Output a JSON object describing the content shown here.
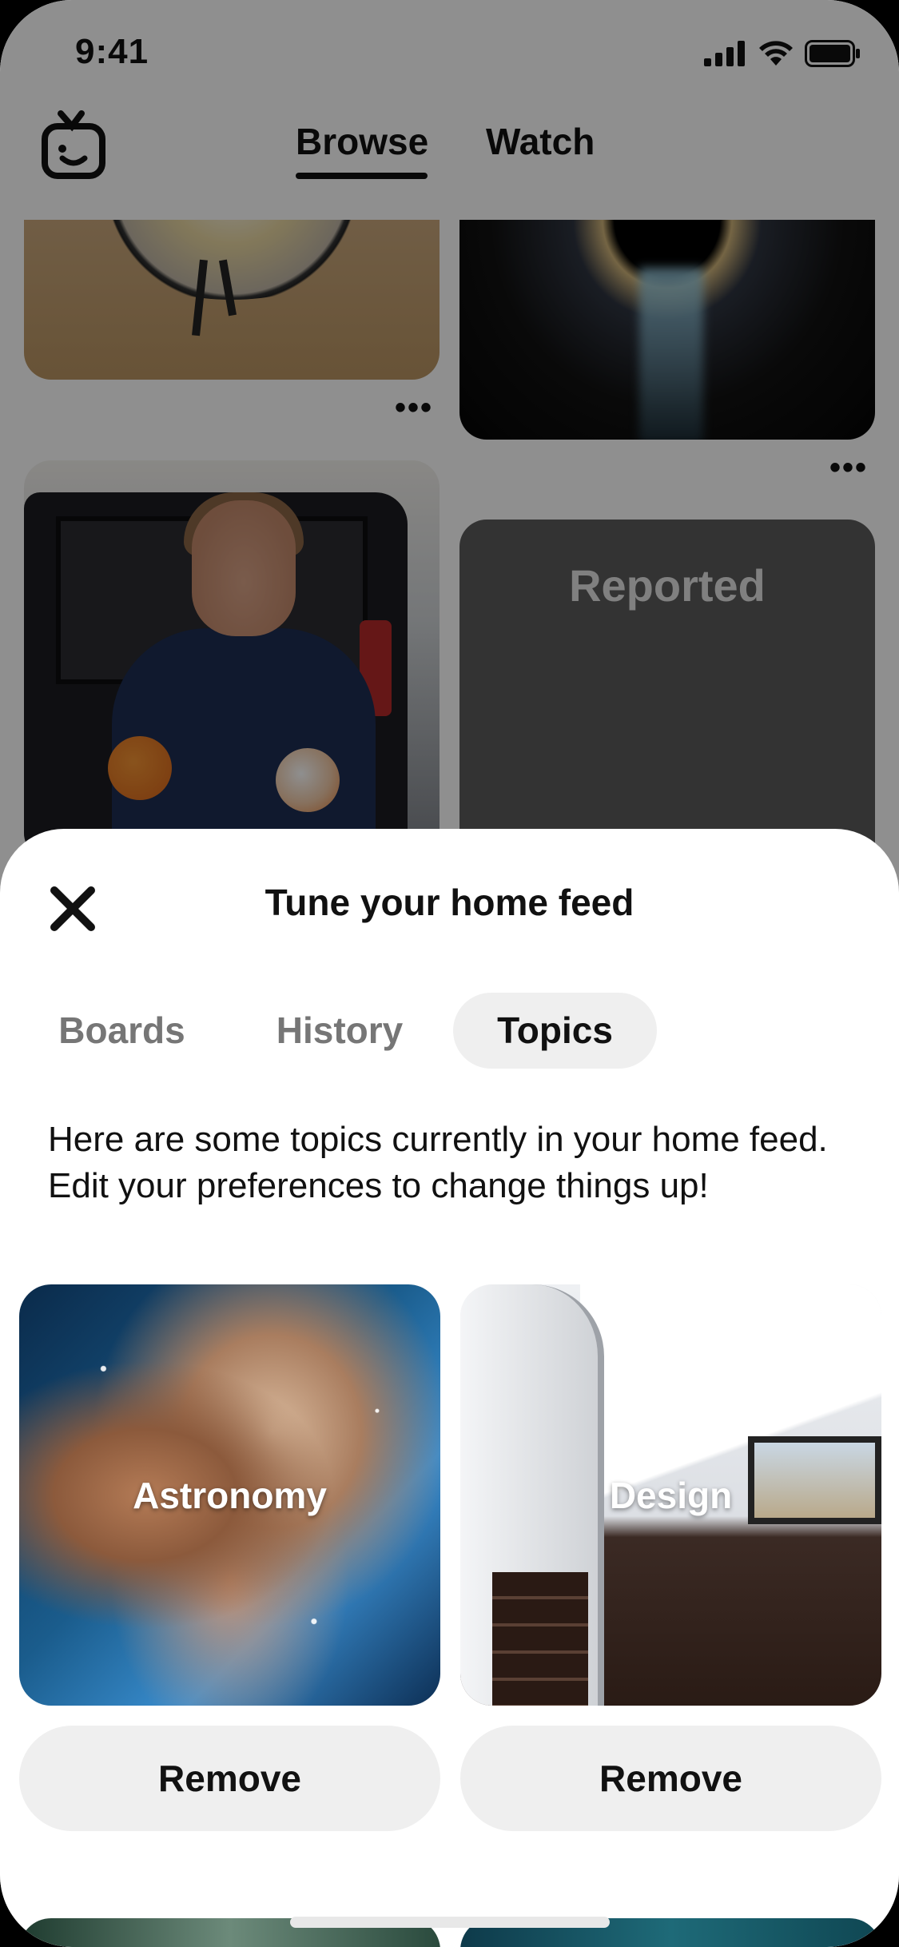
{
  "status_bar": {
    "time": "9:41"
  },
  "header": {
    "tabs": [
      {
        "label": "Browse",
        "active": true
      },
      {
        "label": "Watch",
        "active": false
      }
    ]
  },
  "feed": {
    "reported_label": "Reported",
    "more_glyph": "•••"
  },
  "sheet": {
    "title": "Tune your home feed",
    "segments": [
      {
        "label": "Boards",
        "selected": false
      },
      {
        "label": "History",
        "selected": false
      },
      {
        "label": "Topics",
        "selected": true
      }
    ],
    "description": "Here are some topics currently in your home feed. Edit your preferences to change things up!",
    "topics": [
      {
        "name": "Astronomy",
        "button_label": "Remove"
      },
      {
        "name": "Design",
        "button_label": "Remove"
      }
    ]
  },
  "colors": {
    "overlay": "#000000",
    "pill_background": "#efefef",
    "muted_text": "#767676",
    "text": "#111111"
  }
}
